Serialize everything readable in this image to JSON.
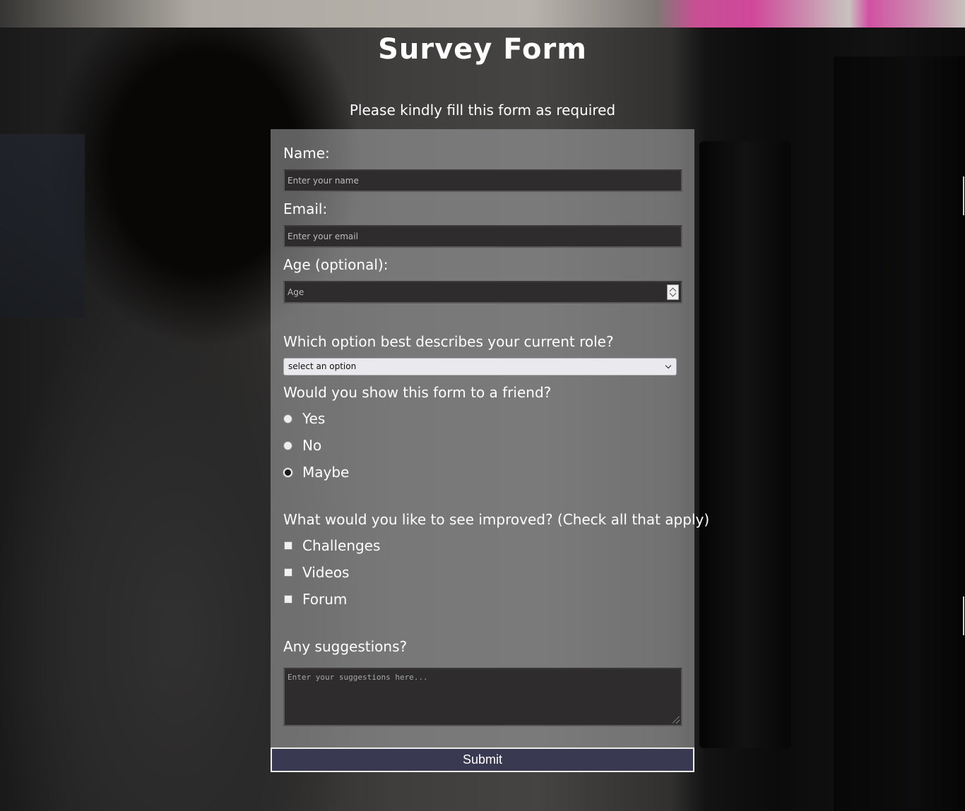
{
  "header": {
    "title": "Survey Form",
    "subtitle": "Please kindly fill this form as required"
  },
  "form": {
    "name": {
      "label": "Name:",
      "placeholder": "Enter your name",
      "value": ""
    },
    "email": {
      "label": "Email:",
      "placeholder": "Enter your email",
      "value": ""
    },
    "age": {
      "label": "Age (optional):",
      "placeholder": "Age",
      "value": ""
    },
    "role": {
      "label": "Which option best describes your current role?",
      "selected": "select an option"
    },
    "recommend": {
      "label": "Would you show this form to a friend?",
      "options": [
        {
          "label": "Yes",
          "checked": false
        },
        {
          "label": "No",
          "checked": false
        },
        {
          "label": "Maybe",
          "checked": true
        }
      ]
    },
    "improvements": {
      "label": "What would you like to see improved? (Check all that apply)",
      "options": [
        {
          "label": "Challenges",
          "checked": false
        },
        {
          "label": "Videos",
          "checked": false
        },
        {
          "label": "Forum",
          "checked": false
        }
      ]
    },
    "suggestions": {
      "label": "Any suggestions?",
      "placeholder": "Enter your suggestions here...",
      "value": ""
    },
    "submit_label": "Submit"
  },
  "colors": {
    "submit_bg": "#393a52",
    "panel_bg": "rgba(168,168,170,0.55)",
    "field_bg": "#2e2c2c"
  }
}
